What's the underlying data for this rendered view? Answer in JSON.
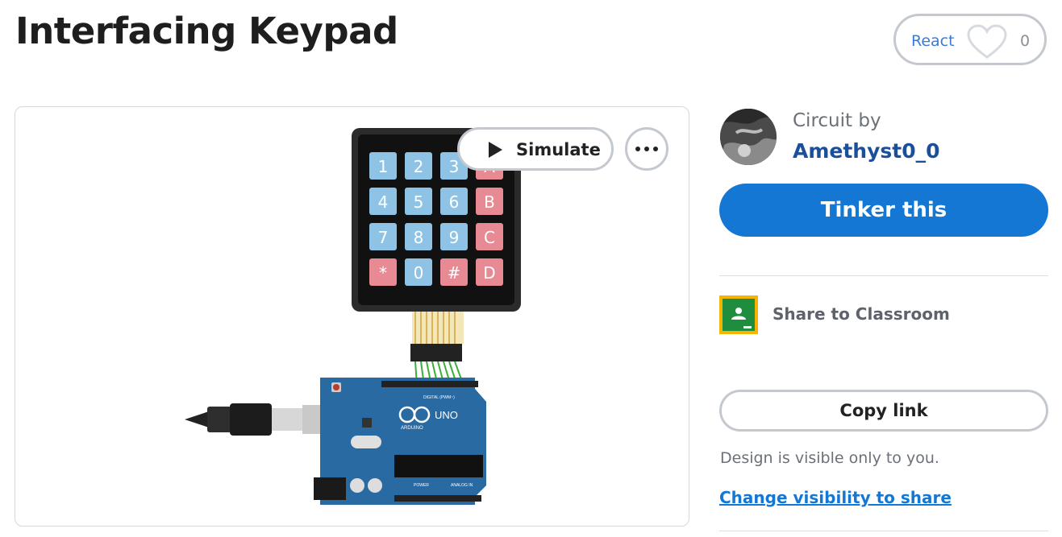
{
  "page": {
    "title": "Interfacing Keypad"
  },
  "react": {
    "label": "React",
    "count": "0",
    "icon": "heart-icon"
  },
  "viewer": {
    "simulate_label": "Simulate",
    "more_icon": "more-icon",
    "keypad_keys": [
      "1",
      "2",
      "3",
      "A",
      "4",
      "5",
      "6",
      "B",
      "7",
      "8",
      "9",
      "C",
      "*",
      "0",
      "#",
      "D"
    ],
    "board_labels": {
      "brand": "ARDUINO",
      "model": "UNO",
      "digital": "DIGITAL (PWM~)",
      "power": "POWER",
      "analog": "ANALOG IN"
    }
  },
  "author": {
    "caption": "Circuit by",
    "name": "Amethyst0_0"
  },
  "actions": {
    "tinker_label": "Tinker this",
    "share_label": "Share to Classroom",
    "copy_label": "Copy link",
    "visibility_note": "Design is visible only to you.",
    "visibility_link": "Change visibility to share"
  },
  "colors": {
    "accent": "#1477d4",
    "author": "#1a4f9c",
    "key_blue": "#8ec3e6",
    "key_red": "#e88a94",
    "board": "#2a6aa3"
  }
}
